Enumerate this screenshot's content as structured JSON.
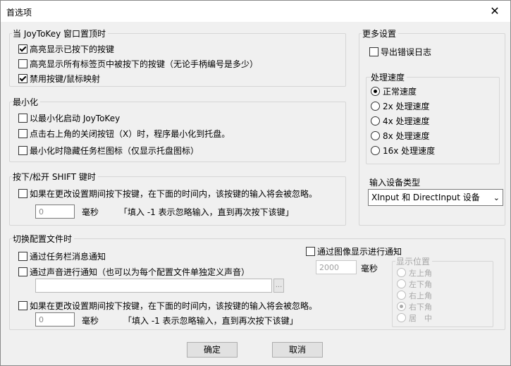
{
  "window": {
    "title": "首选项"
  },
  "g_top": {
    "label": "当 JoyToKey 窗口置顶时",
    "items": [
      {
        "label": "高亮显示已按下的按键",
        "checked": true
      },
      {
        "label": "高亮显示所有标签页中被按下的按键（无论手柄编号是多少）",
        "checked": false
      },
      {
        "label": "禁用按键/鼠标映射",
        "checked": true
      }
    ]
  },
  "g_min": {
    "label": "最小化",
    "items": [
      {
        "label": "以最小化启动 JoyToKey",
        "checked": false
      },
      {
        "label": "点击右上角的关闭按钮（X）时，程序最小化到托盘。",
        "checked": false
      },
      {
        "label": "最小化时隐藏任务栏图标（仅显示托盘图标）",
        "checked": false
      }
    ]
  },
  "g_shift": {
    "label": "按下/松开 SHIFT 键时",
    "ignore_label": "如果在更改设置期间按下按键，在下面的时间内，该按键的输入将会被忽略。",
    "ms_value": "0",
    "ms_unit": "毫秒",
    "hint": "「填入 -1 表示忽略输入，直到再次按下该键」"
  },
  "g_more": {
    "label": "更多设置",
    "export_log": "导出错误日志",
    "speed": {
      "label": "处理速度",
      "options": [
        "正常速度",
        "2x  处理速度",
        "4x  处理速度",
        "8x  处理速度",
        "16x 处理速度"
      ],
      "selected": "正常速度"
    },
    "device": {
      "label": "输入设备类型",
      "value": "XInput 和 DirectInput 设备"
    }
  },
  "g_switch": {
    "label": "切换配置文件时",
    "taskbar_notify": "通过任务栏消息通知",
    "sound_notify": "通过声音进行通知（也可以为每个配置文件单独定义声音）",
    "sound_path": "",
    "browse": "...",
    "ignore_label": "如果在更改设置期间按下按键，在下面的时间内，该按键的输入将会被忽略。",
    "ms_value": "0",
    "ms_unit": "毫秒",
    "hint": "「填入 -1 表示忽略输入，直到再次按下该键」",
    "image_notify": "通过图像显示进行通知",
    "image_ms": "2000",
    "image_ms_unit": "毫秒",
    "position": {
      "label": "显示位置",
      "options": [
        "左上角",
        "左下角",
        "右上角",
        "右下角",
        "居　中"
      ],
      "selected": "右下角"
    }
  },
  "footer": {
    "ok": "确定",
    "cancel": "取消"
  }
}
